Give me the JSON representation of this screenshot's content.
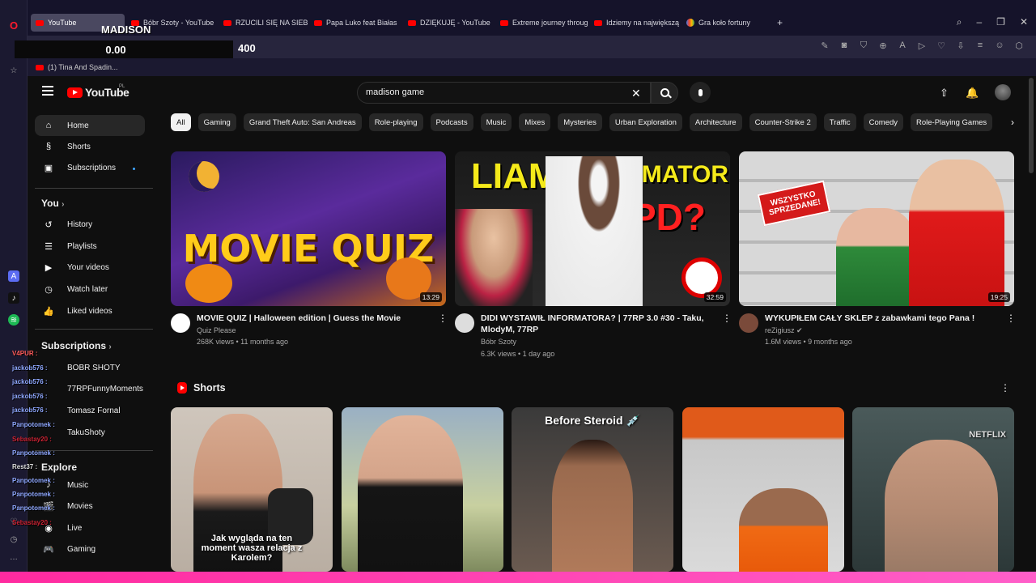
{
  "browser": {
    "tabs": [
      {
        "label": "YouTube",
        "icon": "youtube-favicon",
        "active": true
      },
      {
        "label": "Bóbr Szoty - YouTube",
        "icon": "youtube-favicon"
      },
      {
        "label": "RZUCILI SIĘ NA SIEBIE! SA",
        "icon": "youtube-favicon"
      },
      {
        "label": "Papa Luko feat Białas",
        "icon": "music-icon"
      },
      {
        "label": "DZIĘKUJĘ - YouTube",
        "icon": "youtube-favicon"
      },
      {
        "label": "Extreme journey through",
        "icon": "youtube-favicon"
      },
      {
        "label": "Idziemy na największą fav",
        "icon": "youtube-favicon"
      },
      {
        "label": "Gra koło fortuny",
        "icon": "google-favicon"
      }
    ],
    "new_tab": "+",
    "bookmark": "(1) Tina And Spadin..."
  },
  "overlay": {
    "name": "MADISON",
    "score": "0.00",
    "target": "400"
  },
  "youtube": {
    "logo_text": "YouTube",
    "region": "PL",
    "search_value": "madison game"
  },
  "sidebar": {
    "main": [
      {
        "label": "Home",
        "icon": "home-icon"
      },
      {
        "label": "Shorts",
        "icon": "shorts-icon"
      },
      {
        "label": "Subscriptions",
        "icon": "subscriptions-icon"
      }
    ],
    "you_heading": "You",
    "you": [
      {
        "label": "History",
        "icon": "history-icon"
      },
      {
        "label": "Playlists",
        "icon": "playlists-icon"
      },
      {
        "label": "Your videos",
        "icon": "your-videos-icon"
      },
      {
        "label": "Watch later",
        "icon": "clock-icon"
      },
      {
        "label": "Liked videos",
        "icon": "thumbs-up-icon"
      }
    ],
    "subs_heading": "Subscriptions",
    "subs": [
      "BOBR SHOTY",
      "77RPFunnyMoments",
      "Tomasz Fornal",
      "TakuShoty"
    ],
    "explore_heading": "Explore",
    "explore": [
      {
        "label": "Music",
        "icon": "music-icon"
      },
      {
        "label": "Movies",
        "icon": "movies-icon"
      },
      {
        "label": "Live",
        "icon": "live-icon"
      },
      {
        "label": "Gaming",
        "icon": "gaming-icon"
      }
    ]
  },
  "chips": [
    "All",
    "Gaming",
    "Grand Theft Auto: San Andreas",
    "Role-playing",
    "Podcasts",
    "Music",
    "Mixes",
    "Mysteries",
    "Urban Exploration",
    "Architecture",
    "Counter-Strike 2",
    "Traffic",
    "Comedy",
    "Role-Playing Games"
  ],
  "videos": [
    {
      "title": "MOVIE QUIZ | Halloween edition | Guess the Movie",
      "channel": "Quiz Please",
      "stats": "268K views • 11 months ago",
      "duration": "13:29",
      "thumb_text": "MOVIE QUIZ"
    },
    {
      "title": "DIDI WYSTAWIŁ INFORMATORA? | 77RP 3.0 #30 - Taku, MlodyM, 77RP",
      "channel": "Bóbr Szoty",
      "stats": "6.3K views • 1 day ago",
      "duration": "32:59",
      "thumb_text_left": "LIAM",
      "thumb_text_right": "INFORMATOR",
      "thumb_text_pd": "PD?"
    },
    {
      "title": "WYKUPIŁEM CAŁY SKLEP z zabawkami tego Pana !",
      "channel": "reZigiusz",
      "stats": "1.6M views • 9 months ago",
      "duration": "19:25",
      "thumb_text": "WSZYSTKO SPRZEDANE!"
    }
  ],
  "shorts": {
    "heading": "Shorts",
    "items": [
      {
        "overlay": "Jak wygląda na ten moment wasza relacja z Karolem?"
      },
      {
        "overlay": ""
      },
      {
        "overlay": "Before Steroid 💉"
      },
      {
        "overlay": ""
      },
      {
        "overlay": "NETFLIX"
      }
    ]
  },
  "chat": [
    {
      "user": "V4PUR :"
    },
    {
      "user": "jackob576 :"
    },
    {
      "user": "jackob576 :"
    },
    {
      "user": "jackob576 :"
    },
    {
      "user": "jackob576 :"
    },
    {
      "user": "Panpotomek :"
    },
    {
      "user": "Sebastay20 :"
    },
    {
      "user": "Panpotomek :"
    },
    {
      "user": "Rest37 :"
    },
    {
      "user": "Panpotomek :"
    },
    {
      "user": "Panpotomek :"
    },
    {
      "user": "Panpotomek :"
    },
    {
      "user": "Sebastay20 :"
    }
  ],
  "colors": {
    "accent": "#ff0000",
    "chip_active": "#f1f1f1",
    "bg": "#0f0f0f",
    "bottom_bar": "#ff2a9f"
  }
}
